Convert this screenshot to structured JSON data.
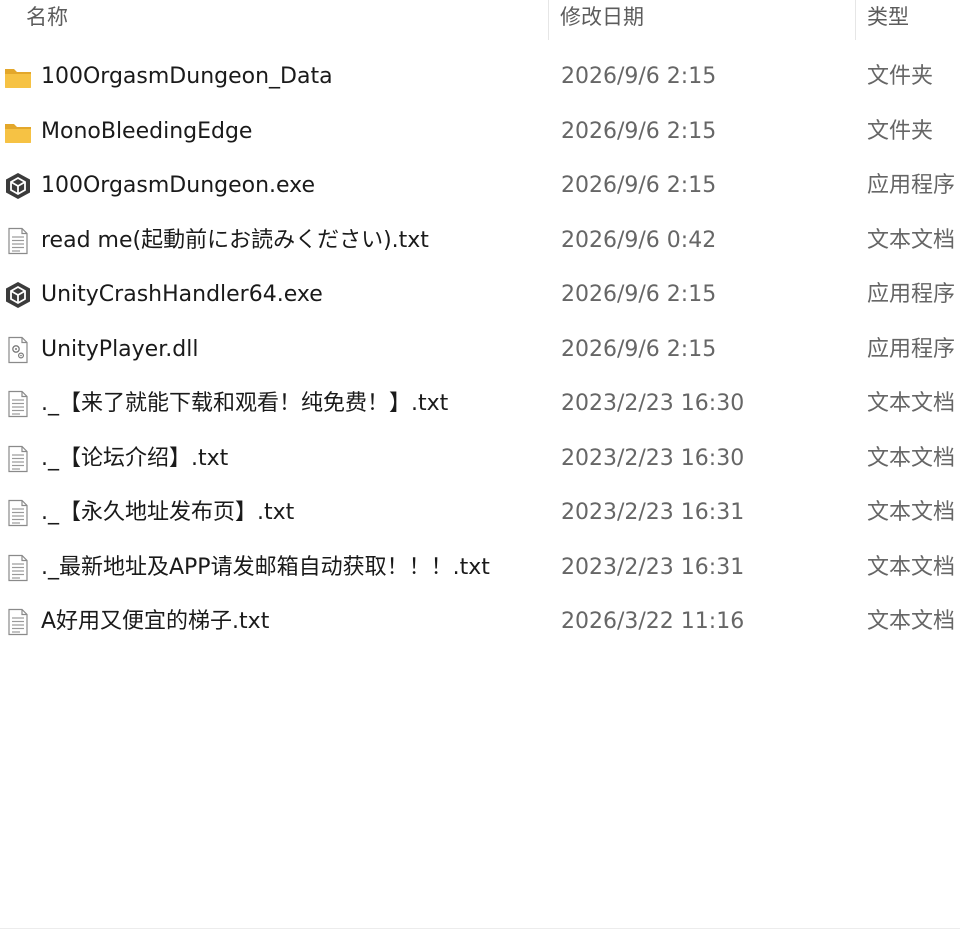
{
  "header": {
    "name_label": "名称",
    "date_label": "修改日期",
    "type_label": "类型"
  },
  "files": [
    {
      "name": "100OrgasmDungeon_Data",
      "date": "2026/9/6 2:15",
      "type": "文件夹",
      "icon": "folder-icon"
    },
    {
      "name": "MonoBleedingEdge",
      "date": "2026/9/6 2:15",
      "type": "文件夹",
      "icon": "folder-icon"
    },
    {
      "name": "100OrgasmDungeon.exe",
      "date": "2026/9/6 2:15",
      "type": "应用程序",
      "icon": "unity-icon"
    },
    {
      "name": "read me(起動前にお読みください).txt",
      "date": "2026/9/6 0:42",
      "type": "文本文档",
      "icon": "text-file-icon"
    },
    {
      "name": "UnityCrashHandler64.exe",
      "date": "2026/9/6 2:15",
      "type": "应用程序",
      "icon": "unity-icon"
    },
    {
      "name": "UnityPlayer.dll",
      "date": "2026/9/6 2:15",
      "type": "应用程序",
      "icon": "dll-file-icon"
    },
    {
      "name": "._【来了就能下载和观看！纯免费！】.txt",
      "date": "2023/2/23 16:30",
      "type": "文本文档",
      "icon": "text-file-icon"
    },
    {
      "name": "._【论坛介绍】.txt",
      "date": "2023/2/23 16:30",
      "type": "文本文档",
      "icon": "text-file-icon"
    },
    {
      "name": "._【永久地址发布页】.txt",
      "date": "2023/2/23 16:31",
      "type": "文本文档",
      "icon": "text-file-icon"
    },
    {
      "name": "._最新地址及APP请发邮箱自动获取！！！.txt",
      "date": "2023/2/23 16:31",
      "type": "文本文档",
      "icon": "text-file-icon"
    },
    {
      "name": "A好用又便宜的梯子.txt",
      "date": "2026/3/22 11:16",
      "type": "文本文档",
      "icon": "text-file-icon"
    }
  ],
  "colors": {
    "folder": "#f6c244",
    "folder_dark": "#e3a72b",
    "unity": "#3b3b3b"
  }
}
